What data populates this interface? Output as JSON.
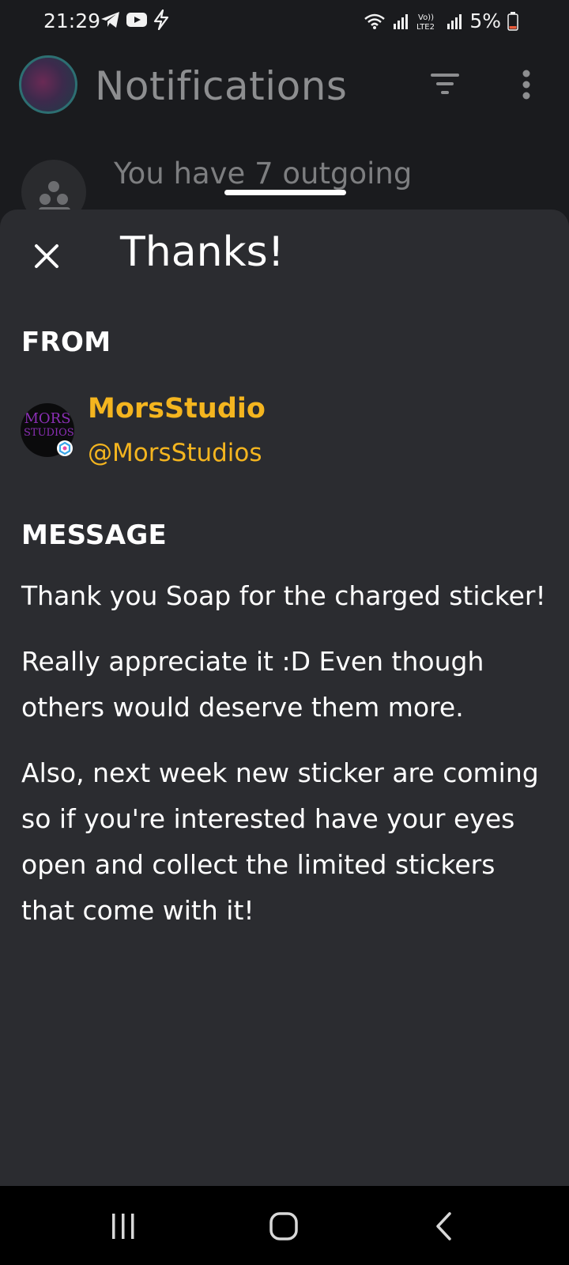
{
  "status_bar": {
    "time": "21:29",
    "battery_percent": "5%",
    "icons_left": [
      "telegram-icon",
      "youtube-icon",
      "bolt-icon"
    ],
    "icons_right": [
      "wifi-icon",
      "signal-icon",
      "volte-icon",
      "signal-icon",
      "battery-icon"
    ]
  },
  "background": {
    "title": "Notifications",
    "row_text": "You have 7 outgoing"
  },
  "sheet": {
    "title": "Thanks!",
    "from_label": "FROM",
    "sender": {
      "name": "MorsStudio",
      "handle": "@MorsStudios",
      "avatar_text_line1": "MORS",
      "avatar_text_line2": "STUDIOS"
    },
    "message_label": "MESSAGE",
    "message_paragraphs": [
      "Thank you Soap for the charged sticker!",
      "Really appreciate it :D Even though others would deserve them more.",
      "Also, next week new sticker are coming so if you're interested have your eyes open and collect the limited stickers that come with it!"
    ]
  },
  "colors": {
    "accent": "#f4b51f",
    "sheet_bg": "#2b2c30",
    "app_bg": "#1a1b1e"
  }
}
